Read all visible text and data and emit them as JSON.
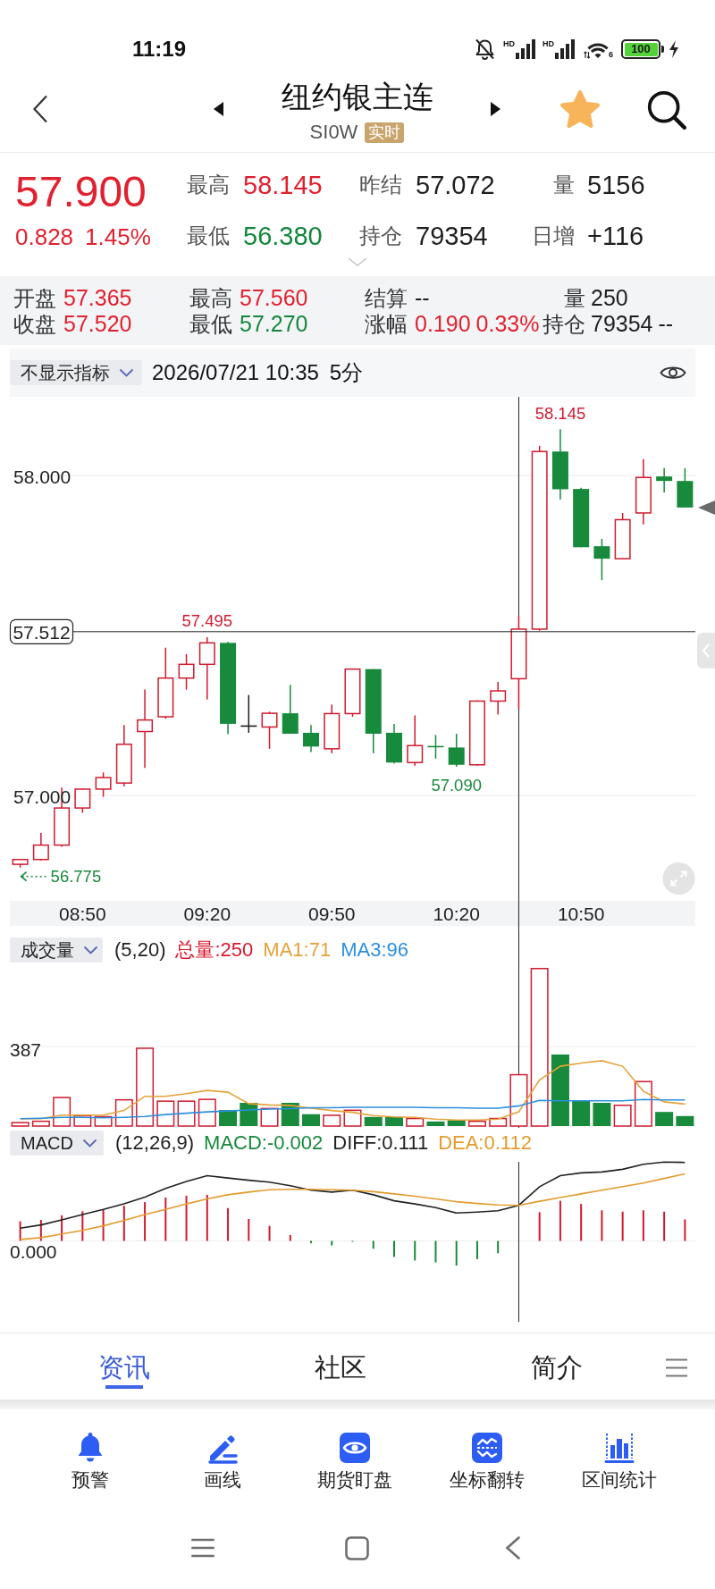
{
  "status_bar": {
    "time": "11:19",
    "networks": [
      {
        "label": "HD"
      },
      {
        "label": "HD"
      }
    ],
    "wifi_label": "6",
    "battery": "100"
  },
  "header": {
    "title": "纽约银主连",
    "code": "SI0W",
    "badge": "实时",
    "favorite": true
  },
  "quote": {
    "price": "57.900",
    "change": "0.828",
    "change_percent": "1.45%",
    "color": "#e0212f",
    "stats": [
      {
        "label": "最高",
        "value": "58.145",
        "color": "#e0212f"
      },
      {
        "label": "昨结",
        "value": "57.072",
        "color": "#1e1e1e"
      },
      {
        "label": "量",
        "value": "5156",
        "color": "#1e1e1e"
      },
      {
        "label": "最低",
        "value": "56.380",
        "color": "#13873b"
      },
      {
        "label": "持仓",
        "value": "79354",
        "color": "#1e1e1e"
      },
      {
        "label": "日增",
        "value": "+116",
        "color": "#1e1e1e"
      }
    ]
  },
  "bar_info": {
    "rows": [
      [
        {
          "label": "开盘",
          "values": [
            "57.365"
          ],
          "color": "#e0212f"
        },
        {
          "label": "最高",
          "values": [
            "57.560"
          ],
          "color": "#e0212f"
        },
        {
          "label": "结算",
          "values": [
            "--"
          ],
          "color": "#1e1e1e"
        },
        {
          "label": "量",
          "values": [
            "250"
          ],
          "color": "#1e1e1e"
        }
      ],
      [
        {
          "label": "收盘",
          "values": [
            "57.520"
          ],
          "color": "#e0212f"
        },
        {
          "label": "最低",
          "values": [
            "57.270"
          ],
          "color": "#13873b"
        },
        {
          "label": "涨幅",
          "values": [
            "0.190",
            "0.33%"
          ],
          "color": "#e0212f"
        },
        {
          "label": "持仓",
          "values": [
            "79354",
            "--"
          ],
          "color": "#1e1e1e"
        }
      ]
    ]
  },
  "chart": {
    "indicator": "不显示指标",
    "datetime": "2026/07/21 10:35",
    "period": "5分",
    "price_ticks": [
      "58.000",
      "57.000"
    ],
    "time_ticks": [
      "08:50",
      "09:20",
      "09:50",
      "10:20",
      "10:50"
    ],
    "extreme_labels": [
      {
        "text": "58.145",
        "kind": "max"
      },
      {
        "text": "57.495",
        "kind": "max"
      },
      {
        "text": "57.090",
        "kind": "min"
      },
      {
        "text": "56.775",
        "kind": "min_pointer"
      }
    ],
    "crosshair_label": "57.512"
  },
  "volume": {
    "indicator": "成交量",
    "legend": [
      {
        "text": "(5,20)",
        "color": "#222222"
      },
      {
        "text": "总量:250",
        "color": "#d7192d"
      },
      {
        "text": "MA1:71",
        "color": "#e6a23a"
      },
      {
        "text": "MA3:96",
        "color": "#2b8fe0"
      }
    ],
    "tick": "387"
  },
  "macd": {
    "indicator": "MACD",
    "legend": [
      {
        "text": "(12,26,9)",
        "color": "#222222"
      },
      {
        "text": "MACD:-0.002",
        "color": "#17883b"
      },
      {
        "text": "DIFF:0.111",
        "color": "#222222"
      },
      {
        "text": "DEA:0.112",
        "color": "#e39b2d"
      }
    ],
    "tick": "0.000"
  },
  "tabs": [
    {
      "label": "资讯",
      "selected": true
    },
    {
      "label": "社区",
      "selected": false
    },
    {
      "label": "简介",
      "selected": false
    }
  ],
  "tools": [
    {
      "label": "预警",
      "kind": "alert"
    },
    {
      "label": "画线",
      "kind": "draw"
    },
    {
      "label": "期货盯盘",
      "kind": "monitor"
    },
    {
      "label": "坐标翻转",
      "kind": "flip"
    },
    {
      "label": "区间统计",
      "kind": "range"
    }
  ]
}
